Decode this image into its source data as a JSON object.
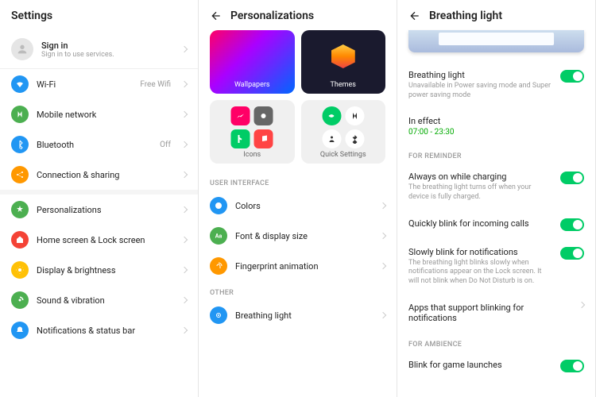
{
  "panel1": {
    "title": "Settings",
    "signin": {
      "title": "Sign in",
      "sub": "Sign in to use services."
    },
    "group1": [
      {
        "icon": "wifi",
        "color": "#2196f3",
        "label": "Wi-Fi",
        "value": "Free Wifi"
      },
      {
        "icon": "mobile",
        "color": "#4caf50",
        "label": "Mobile network",
        "value": ""
      },
      {
        "icon": "bluetooth",
        "color": "#2196f3",
        "label": "Bluetooth",
        "value": "Off"
      },
      {
        "icon": "share",
        "color": "#ff9800",
        "label": "Connection & sharing",
        "value": ""
      }
    ],
    "group2": [
      {
        "icon": "personalize",
        "color": "#4caf50",
        "label": "Personalizations"
      },
      {
        "icon": "home",
        "color": "#f44336",
        "label": "Home screen & Lock screen"
      },
      {
        "icon": "display",
        "color": "#ffc107",
        "label": "Display & brightness"
      },
      {
        "icon": "sound",
        "color": "#4caf50",
        "label": "Sound & vibration"
      },
      {
        "icon": "notif",
        "color": "#2196f3",
        "label": "Notifications & status bar"
      }
    ]
  },
  "panel2": {
    "title": "Personalizations",
    "tiles": {
      "wallpapers": "Wallpapers",
      "themes": "Themes",
      "icons": "Icons",
      "quick": "Quick Settings"
    },
    "sect1": "USER INTERFACE",
    "ui": [
      {
        "icon": "colors",
        "color": "#2196f3",
        "label": "Colors"
      },
      {
        "icon": "font",
        "color": "#4caf50",
        "label": "Font & display size"
      },
      {
        "icon": "finger",
        "color": "#ff9800",
        "label": "Fingerprint animation"
      }
    ],
    "sect2": "OTHER",
    "other": [
      {
        "icon": "breathe",
        "color": "#2196f3",
        "label": "Breathing light"
      }
    ]
  },
  "panel3": {
    "title": "Breathing light",
    "main": {
      "title": "Breathing light",
      "sub": "Unavailable in Power saving mode and Super power saving mode"
    },
    "effect": {
      "title": "In effect",
      "time": "07:00 - 23:30"
    },
    "sect1": "FOR REMINDER",
    "reminder": [
      {
        "title": "Always on while charging",
        "sub": "The breathing light turns off when your device is fully charged.",
        "toggle": true
      },
      {
        "title": "Quickly blink for incoming calls",
        "sub": "",
        "toggle": true
      },
      {
        "title": "Slowly blink for notifications",
        "sub": "The breathing light blinks slowly when notifications appear on the Lock screen. It will not blink when Do Not Disturb is on.",
        "toggle": true
      },
      {
        "title": "Apps that support blinking for notifications",
        "sub": "",
        "toggle": false,
        "chev": true
      }
    ],
    "sect2": "FOR AMBIENCE",
    "ambience": [
      {
        "title": "Blink for game launches",
        "toggle": true
      }
    ]
  }
}
